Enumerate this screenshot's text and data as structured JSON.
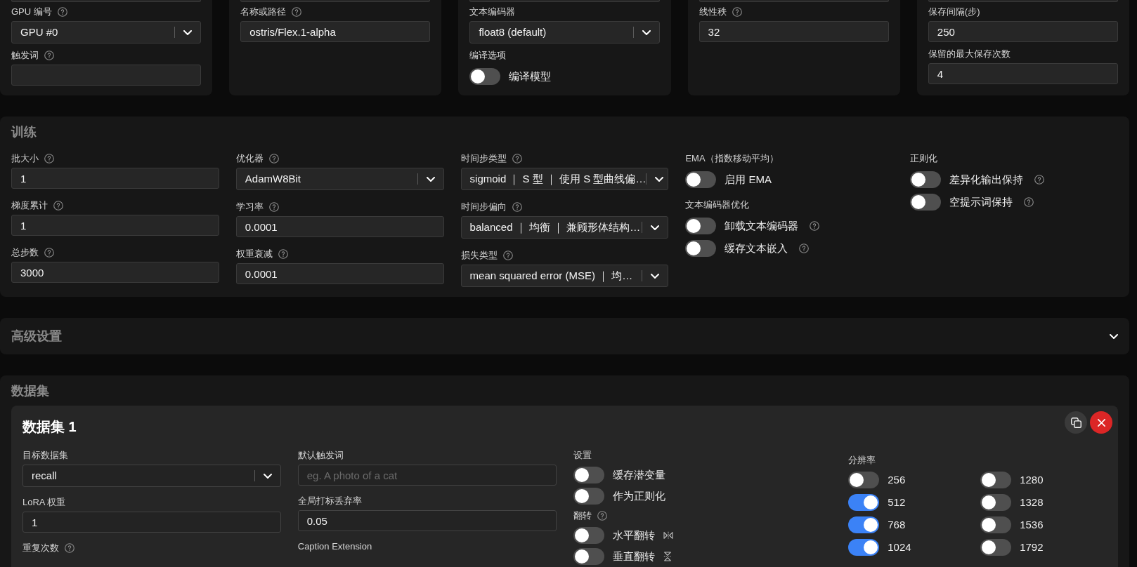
{
  "top_cards": [
    {
      "fields": [
        {
          "kind": "select",
          "label": "GPU 编号",
          "help": true,
          "value": "GPU #0"
        },
        {
          "kind": "input",
          "label": "触发词",
          "help": true
        }
      ]
    },
    {
      "fields": [
        {
          "kind": "input",
          "label": "名称或路径",
          "help": true,
          "value": "ostris/Flex.1-alpha"
        }
      ]
    },
    {
      "fields": [
        {
          "kind": "select",
          "label": "文本编码器",
          "value": "float8 (default)"
        },
        {
          "kind": "switches",
          "label": "编译选项",
          "switches": [
            {
              "label": "编译模型",
              "on": false
            }
          ]
        }
      ]
    },
    {
      "fields": [
        {
          "kind": "input",
          "label": "线性秩",
          "help": true,
          "value": "32"
        }
      ]
    },
    {
      "fields": [
        {
          "kind": "input",
          "label": "保存间隔(步)",
          "value": "250"
        },
        {
          "kind": "input",
          "label": "保留的最大保存次数",
          "value": "4"
        }
      ]
    }
  ],
  "training": {
    "title": "训练",
    "columns": [
      [
        {
          "kind": "input",
          "label": "批大小",
          "help": true,
          "value": "1"
        },
        {
          "kind": "input",
          "label": "梯度累计",
          "help": true,
          "value": "1"
        },
        {
          "kind": "input",
          "label": "总步数",
          "help": true,
          "value": "3000"
        }
      ],
      [
        {
          "kind": "select",
          "label": "优化器",
          "help": true,
          "value": "AdamW8Bit"
        },
        {
          "kind": "input",
          "label": "学习率",
          "help": true,
          "value": "0.0001"
        },
        {
          "kind": "input",
          "label": "权重衰减",
          "help": true,
          "value": "0.0001"
        }
      ],
      [
        {
          "kind": "select",
          "label": "时间步类型",
          "help": true,
          "value": "sigmoid ｜ S 型 ｜ 使用 S 型曲线偏…"
        },
        {
          "kind": "select",
          "label": "时间步偏向",
          "help": true,
          "value": "balanced ｜ 均衡 ｜ 兼顾形体结构…"
        },
        {
          "kind": "select",
          "label": "损失类型",
          "help": true,
          "value": "mean squared error (MSE) ｜ 均…"
        }
      ],
      [
        {
          "kind": "switches",
          "label": "EMA（指数移动平均）",
          "switches": [
            {
              "label": "启用 EMA",
              "on": false
            }
          ]
        },
        {
          "kind": "switches",
          "label": "文本编码器优化",
          "switches": [
            {
              "label": "卸载文本编码器",
              "on": false,
              "help": true
            },
            {
              "label": "缓存文本嵌入",
              "on": false,
              "help": true
            }
          ]
        }
      ],
      [
        {
          "kind": "switches",
          "label": "正则化",
          "switches": [
            {
              "label": "差异化输出保持",
              "on": false,
              "help": true
            },
            {
              "label": "空提示词保持",
              "on": false,
              "help": true
            }
          ]
        }
      ]
    ]
  },
  "advanced": {
    "title": "高级设置",
    "expanded": false
  },
  "datasets": {
    "title": "数据集",
    "items": [
      {
        "title": "数据集 1",
        "columns": [
          [
            {
              "kind": "select",
              "label": "目标数据集",
              "value": "recall"
            },
            {
              "kind": "input",
              "label": "LoRA 权重",
              "value": "1"
            },
            {
              "kind": "label",
              "label": "重复次数",
              "help": true
            }
          ],
          [
            {
              "kind": "input",
              "label": "默认触发词",
              "placeholder": "eg. A photo of a cat"
            },
            {
              "kind": "input",
              "label": "全局打标丢弃率",
              "value": "0.05"
            },
            {
              "kind": "label",
              "label": "Caption Extension"
            }
          ],
          [
            {
              "kind": "switches",
              "label": "设置",
              "switches": [
                {
                  "label": "缓存潜变量",
                  "on": false
                },
                {
                  "label": "作为正则化",
                  "on": false
                }
              ]
            },
            {
              "kind": "switches",
              "label": "翻转",
              "help": true,
              "switches": [
                {
                  "kind": "hflip",
                  "label": "水平翻转",
                  "on": false
                },
                {
                  "kind": "vflip",
                  "label": "垂直翻转",
                  "on": false
                }
              ]
            }
          ],
          [
            {
              "kind": "toggle_grid",
              "label": "分辨率",
              "options": [
                {
                  "label": "256",
                  "on": false
                },
                {
                  "label": "1280",
                  "on": false
                },
                {
                  "label": "512",
                  "on": true
                },
                {
                  "label": "1328",
                  "on": false
                },
                {
                  "label": "768",
                  "on": true
                },
                {
                  "label": "1536",
                  "on": false
                },
                {
                  "label": "1024",
                  "on": true
                },
                {
                  "label": "1792",
                  "on": false
                }
              ]
            }
          ]
        ]
      }
    ]
  }
}
